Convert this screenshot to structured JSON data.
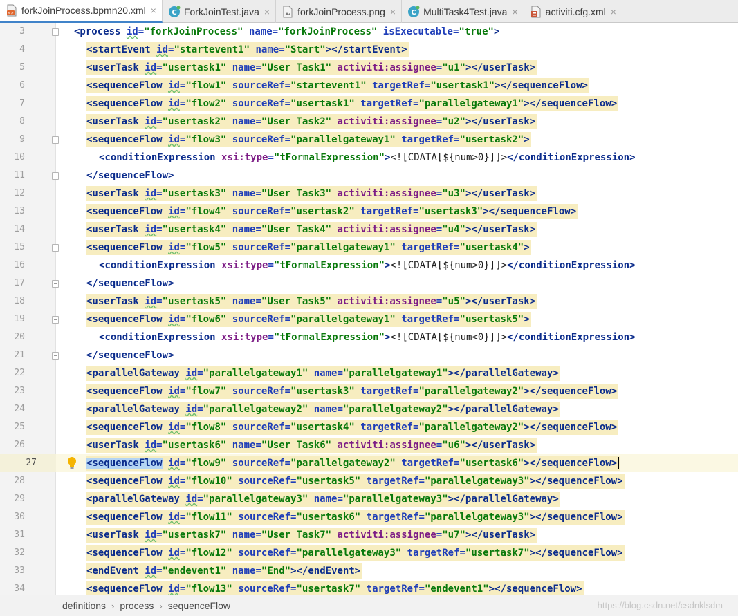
{
  "tabs": [
    {
      "label": "forkJoinProcess.bpmn20.xml",
      "icon": "xml-file-icon",
      "active": true
    },
    {
      "label": "ForkJoinTest.java",
      "icon": "java-class-icon",
      "active": false
    },
    {
      "label": "forkJoinProcess.png",
      "icon": "image-file-icon",
      "active": false
    },
    {
      "label": "MultiTask4Test.java",
      "icon": "java-class-icon",
      "active": false
    },
    {
      "label": "activiti.cfg.xml",
      "icon": "config-file-icon",
      "active": false
    }
  ],
  "tab_close_glyph": "×",
  "editor": {
    "current_line": 27,
    "lines": [
      {
        "n": "3",
        "indent": 0,
        "fold": true,
        "hl": false,
        "text": "<process id=\"forkJoinProcess\" name=\"forkJoinProcess\" isExecutable=\"true\">"
      },
      {
        "n": "4",
        "indent": 1,
        "fold": false,
        "hl": true,
        "text": "<startEvent id=\"startevent1\" name=\"Start\"></startEvent>"
      },
      {
        "n": "5",
        "indent": 1,
        "fold": false,
        "hl": true,
        "text": "<userTask id=\"usertask1\" name=\"User Task1\" activiti:assignee=\"u1\"></userTask>"
      },
      {
        "n": "6",
        "indent": 1,
        "fold": false,
        "hl": true,
        "text": "<sequenceFlow id=\"flow1\" sourceRef=\"startevent1\" targetRef=\"usertask1\"></sequenceFlow>"
      },
      {
        "n": "7",
        "indent": 1,
        "fold": false,
        "hl": true,
        "text": "<sequenceFlow id=\"flow2\" sourceRef=\"usertask1\" targetRef=\"parallelgateway1\"></sequenceFlow>"
      },
      {
        "n": "8",
        "indent": 1,
        "fold": false,
        "hl": true,
        "text": "<userTask id=\"usertask2\" name=\"User Task2\" activiti:assignee=\"u2\"></userTask>"
      },
      {
        "n": "9",
        "indent": 1,
        "fold": true,
        "hl": true,
        "text": "<sequenceFlow id=\"flow3\" sourceRef=\"parallelgateway1\" targetRef=\"usertask2\">"
      },
      {
        "n": "10",
        "indent": 2,
        "fold": false,
        "hl": false,
        "text": "<conditionExpression xsi:type=\"tFormalExpression\"><![CDATA[${num>0}]]></conditionExpression>"
      },
      {
        "n": "11",
        "indent": 1,
        "fold": true,
        "hl": false,
        "text": "</sequenceFlow>"
      },
      {
        "n": "12",
        "indent": 1,
        "fold": false,
        "hl": true,
        "text": "<userTask id=\"usertask3\" name=\"User Task3\" activiti:assignee=\"u3\"></userTask>"
      },
      {
        "n": "13",
        "indent": 1,
        "fold": false,
        "hl": true,
        "text": "<sequenceFlow id=\"flow4\" sourceRef=\"usertask2\" targetRef=\"usertask3\"></sequenceFlow>"
      },
      {
        "n": "14",
        "indent": 1,
        "fold": false,
        "hl": true,
        "text": "<userTask id=\"usertask4\" name=\"User Task4\" activiti:assignee=\"u4\"></userTask>"
      },
      {
        "n": "15",
        "indent": 1,
        "fold": true,
        "hl": true,
        "text": "<sequenceFlow id=\"flow5\" sourceRef=\"parallelgateway1\" targetRef=\"usertask4\">"
      },
      {
        "n": "16",
        "indent": 2,
        "fold": false,
        "hl": false,
        "text": "<conditionExpression xsi:type=\"tFormalExpression\"><![CDATA[${num>0}]]></conditionExpression>"
      },
      {
        "n": "17",
        "indent": 1,
        "fold": true,
        "hl": false,
        "text": "</sequenceFlow>"
      },
      {
        "n": "18",
        "indent": 1,
        "fold": false,
        "hl": true,
        "text": "<userTask id=\"usertask5\" name=\"User Task5\" activiti:assignee=\"u5\"></userTask>"
      },
      {
        "n": "19",
        "indent": 1,
        "fold": true,
        "hl": true,
        "text": "<sequenceFlow id=\"flow6\" sourceRef=\"parallelgateway1\" targetRef=\"usertask5\">"
      },
      {
        "n": "20",
        "indent": 2,
        "fold": false,
        "hl": false,
        "text": "<conditionExpression xsi:type=\"tFormalExpression\"><![CDATA[${num<0}]]></conditionExpression>"
      },
      {
        "n": "21",
        "indent": 1,
        "fold": true,
        "hl": false,
        "text": "</sequenceFlow>"
      },
      {
        "n": "22",
        "indent": 1,
        "fold": false,
        "hl": true,
        "text": "<parallelGateway id=\"parallelgateway1\" name=\"parallelgateway1\"></parallelGateway>"
      },
      {
        "n": "23",
        "indent": 1,
        "fold": false,
        "hl": true,
        "text": "<sequenceFlow id=\"flow7\" sourceRef=\"usertask3\" targetRef=\"parallelgateway2\"></sequenceFlow>"
      },
      {
        "n": "24",
        "indent": 1,
        "fold": false,
        "hl": true,
        "text": "<parallelGateway id=\"parallelgateway2\" name=\"parallelgateway2\"></parallelGateway>"
      },
      {
        "n": "25",
        "indent": 1,
        "fold": false,
        "hl": true,
        "text": "<sequenceFlow id=\"flow8\" sourceRef=\"usertask4\" targetRef=\"parallelgateway2\"></sequenceFlow>"
      },
      {
        "n": "26",
        "indent": 1,
        "fold": false,
        "hl": true,
        "text": "<userTask id=\"usertask6\" name=\"User Task6\" activiti:assignee=\"u6\"></userTask>"
      },
      {
        "n": "27",
        "indent": 1,
        "fold": false,
        "hl": true,
        "text": "<sequenceFlow id=\"flow9\" sourceRef=\"parallelgateway2\" targetRef=\"usertask6\"></sequenceFlow>"
      },
      {
        "n": "28",
        "indent": 1,
        "fold": false,
        "hl": true,
        "text": "<sequenceFlow id=\"flow10\" sourceRef=\"usertask5\" targetRef=\"parallelgateway3\"></sequenceFlow>"
      },
      {
        "n": "29",
        "indent": 1,
        "fold": false,
        "hl": true,
        "text": "<parallelGateway id=\"parallelgateway3\" name=\"parallelgateway3\"></parallelGateway>"
      },
      {
        "n": "30",
        "indent": 1,
        "fold": false,
        "hl": true,
        "text": "<sequenceFlow id=\"flow11\" sourceRef=\"usertask6\" targetRef=\"parallelgateway3\"></sequenceFlow>"
      },
      {
        "n": "31",
        "indent": 1,
        "fold": false,
        "hl": true,
        "text": "<userTask id=\"usertask7\" name=\"User Task7\" activiti:assignee=\"u7\"></userTask>"
      },
      {
        "n": "32",
        "indent": 1,
        "fold": false,
        "hl": true,
        "text": "<sequenceFlow id=\"flow12\" sourceRef=\"parallelgateway3\" targetRef=\"usertask7\"></sequenceFlow>"
      },
      {
        "n": "33",
        "indent": 1,
        "fold": false,
        "hl": true,
        "text": "<endEvent id=\"endevent1\" name=\"End\"></endEvent>"
      },
      {
        "n": "34",
        "indent": 1,
        "fold": false,
        "hl": true,
        "text": "<sequenceFlow id=\"flow13\" sourceRef=\"usertask7\" targetRef=\"endevent1\"></sequenceFlow>"
      }
    ]
  },
  "breadcrumb": [
    "definitions",
    "process",
    "sequenceFlow"
  ],
  "breadcrumb_sep": "›",
  "watermark": "https://blog.csdn.net/csdnklsdm",
  "colors": {
    "tag": "#0b2c8c",
    "attribute": "#1f3eb8",
    "namespace": "#7d1d86",
    "string": "#08790b",
    "highlight": "#f7edc0",
    "current_line": "#fbf8e3",
    "active_tab_underline": "#4083c9"
  }
}
